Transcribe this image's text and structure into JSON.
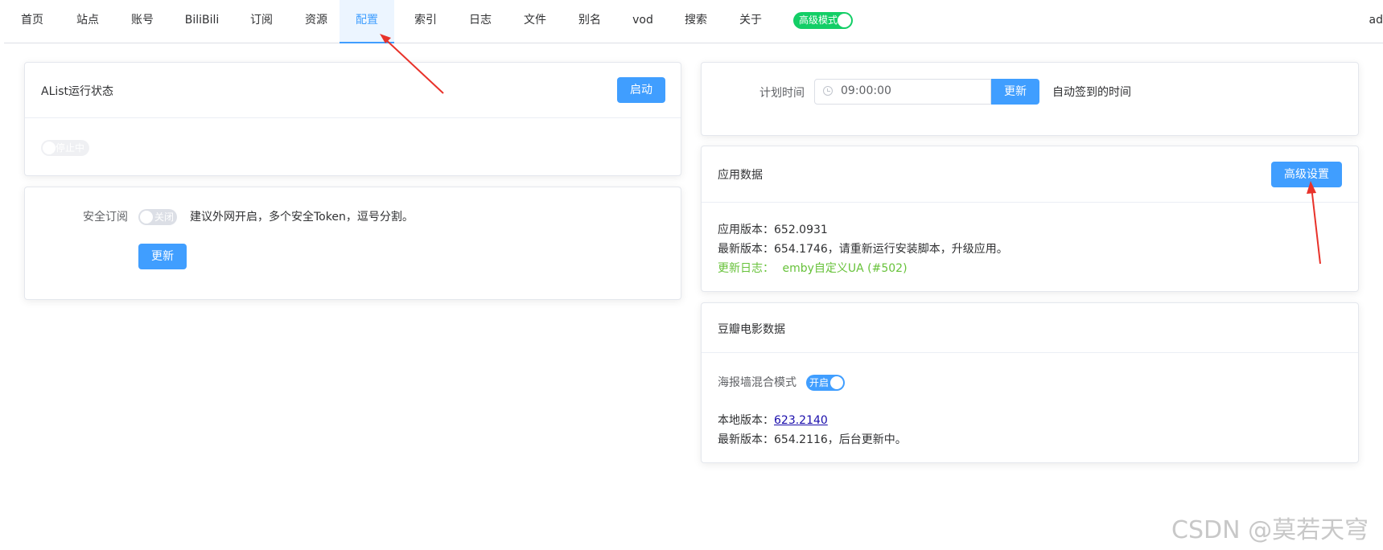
{
  "nav": {
    "items": [
      "首页",
      "站点",
      "账号",
      "BiliBili",
      "订阅",
      "资源",
      "配置",
      "索引",
      "日志",
      "文件",
      "别名",
      "vod",
      "搜索",
      "关于"
    ],
    "active": "配置",
    "advanced_mode_label": "高级模式",
    "user_label": "ad"
  },
  "alist_card": {
    "title": "AList运行状态",
    "start_button": "启动",
    "status_switch": "停止中"
  },
  "security_card": {
    "label": "安全订阅",
    "switch_label": "关闭",
    "hint": "建议外网开启，多个安全Token，逗号分割。",
    "update_button": "更新"
  },
  "schedule_card": {
    "label": "计划时间",
    "time_value": "09:00:00",
    "update_button": "更新",
    "hint": "自动签到的时间"
  },
  "app_card": {
    "title": "应用数据",
    "advanced_button": "高级设置",
    "app_version": "应用版本：652.0931",
    "latest_version": "最新版本：654.1746，请重新运行安装脚本，升级应用。",
    "changelog_label": "更新日志：",
    "changelog_text": "emby自定义UA (#502)"
  },
  "douban_card": {
    "title": "豆瓣电影数据",
    "poster_label": "海报墙混合模式",
    "poster_switch": "开启",
    "local_version_label": "本地版本：",
    "local_version_value": "623.2140",
    "latest_version": "最新版本：654.2116，后台更新中。"
  },
  "colors": {
    "primary": "#409eff",
    "success": "#13ce66",
    "changelog": "#67c23a",
    "arrow": "#e8322a"
  },
  "watermark": "CSDN @莫若天穹"
}
